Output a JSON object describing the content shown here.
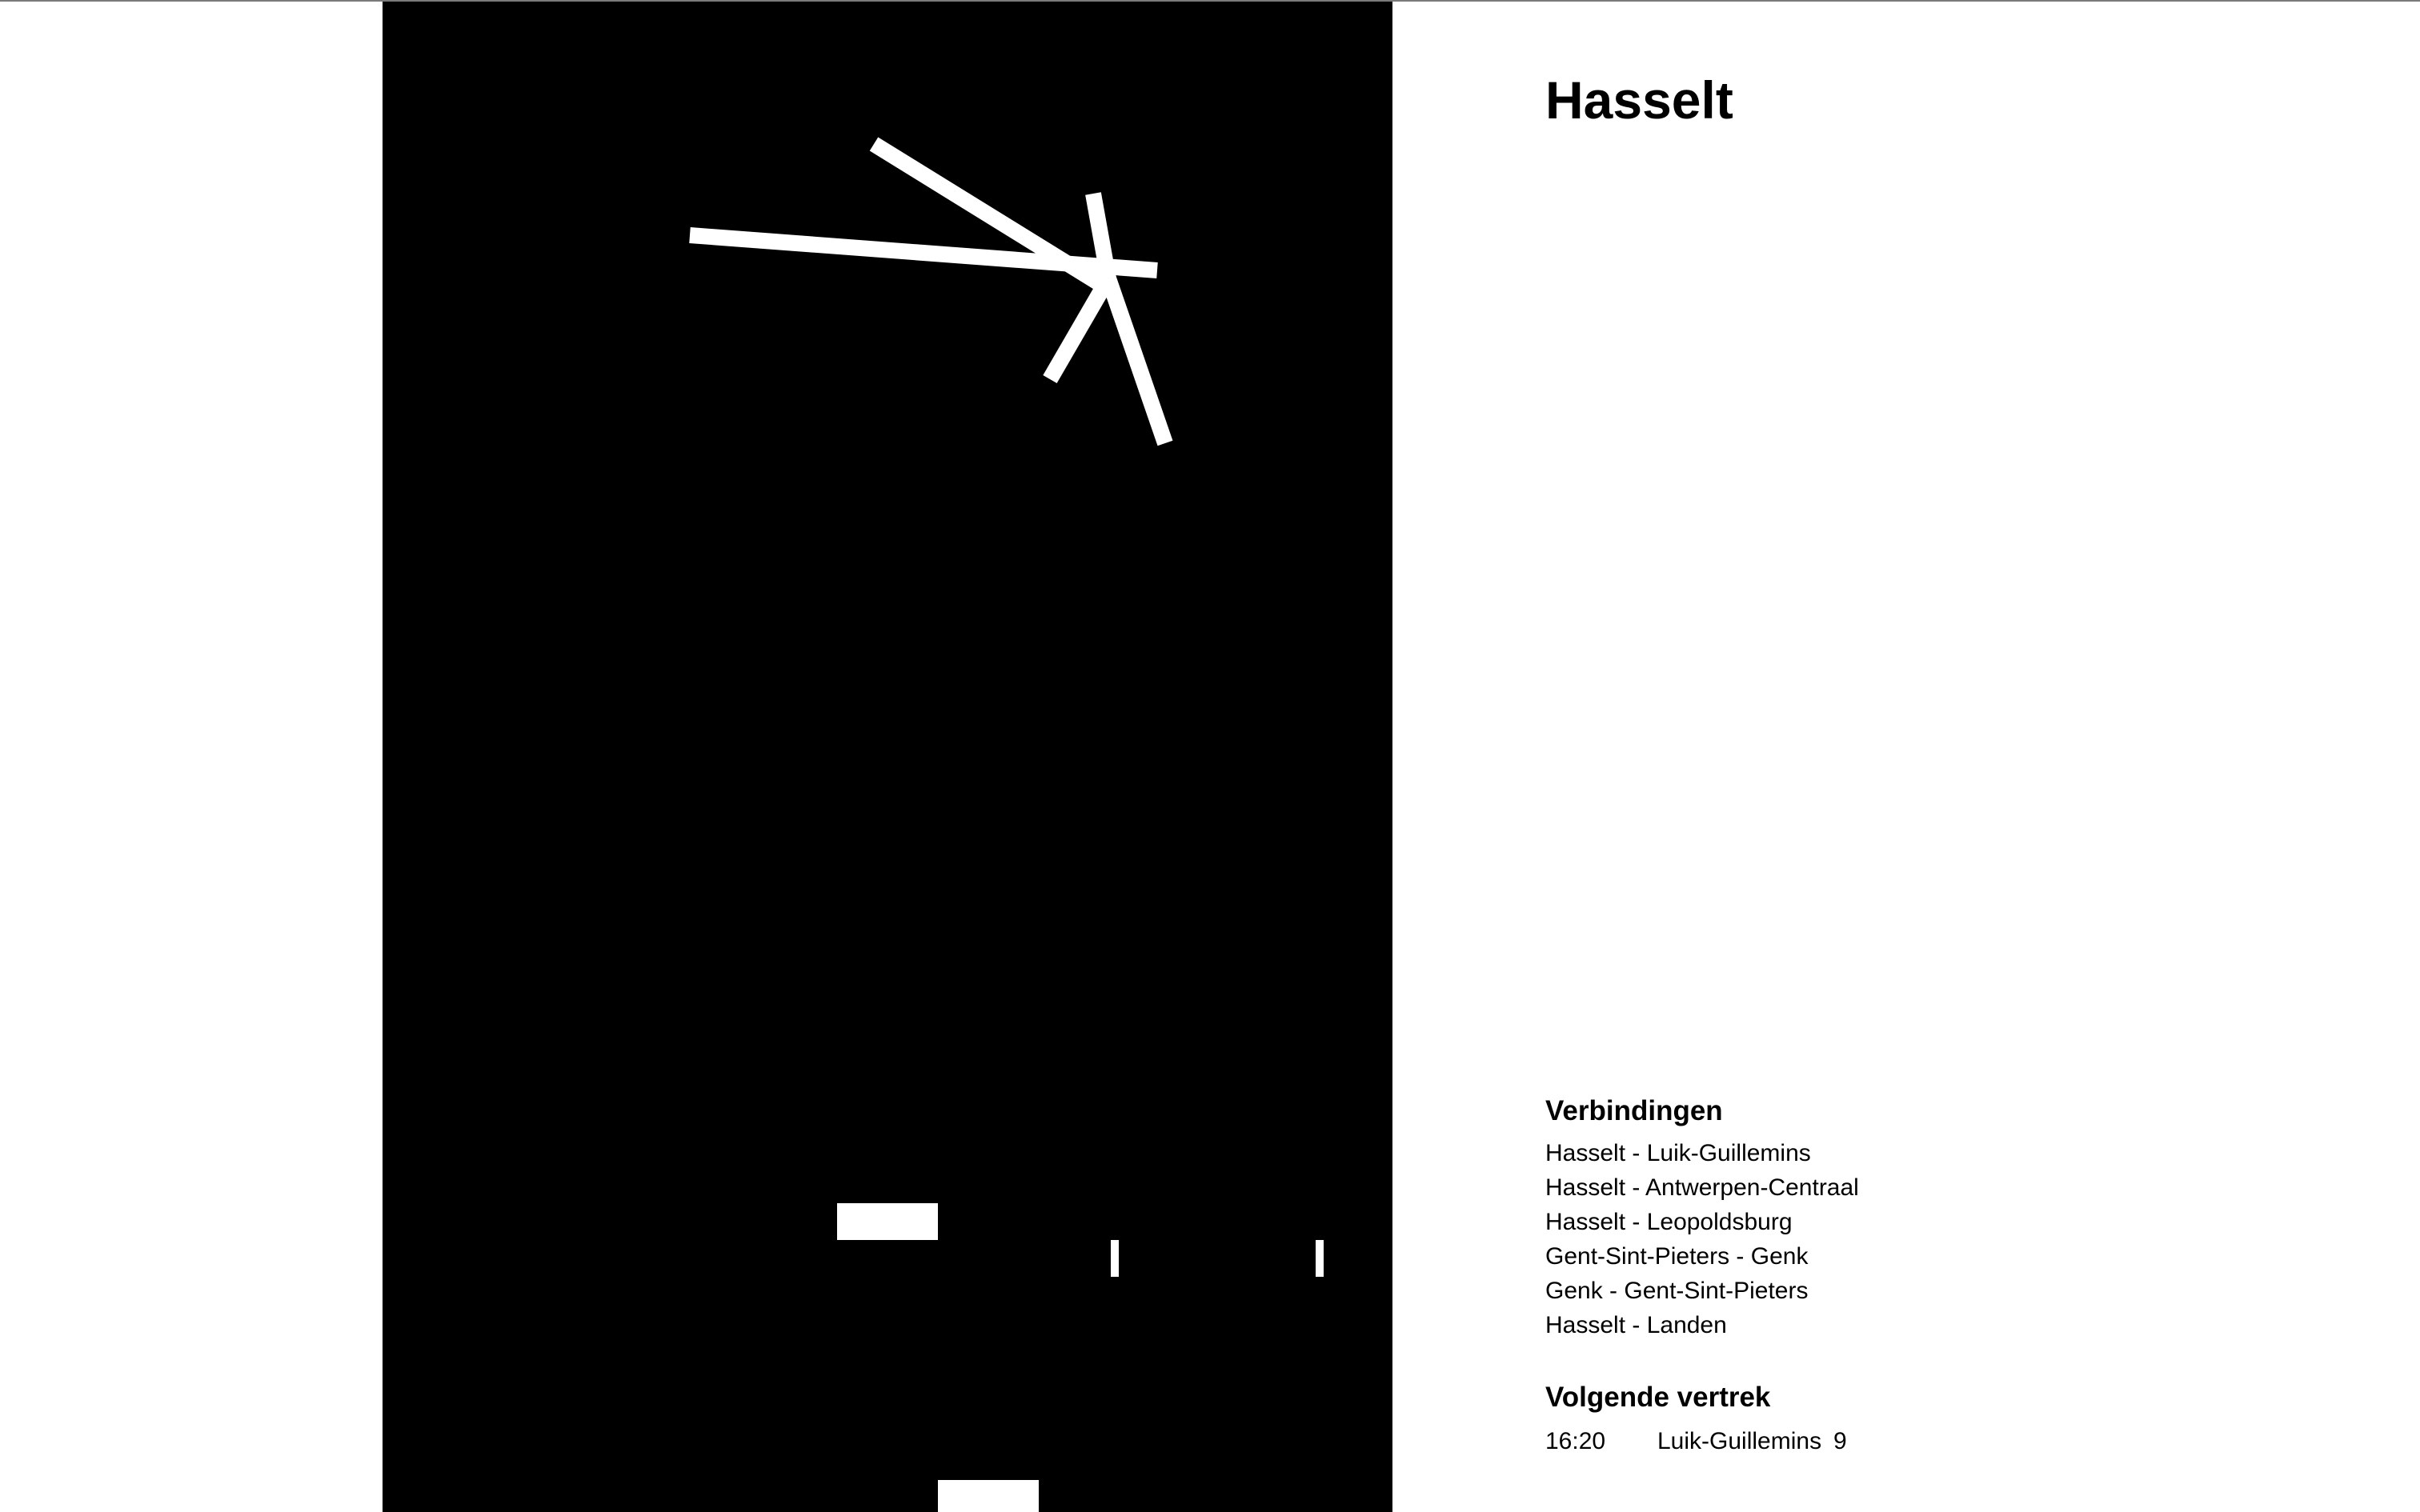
{
  "station": {
    "name": "Hasselt"
  },
  "connections": {
    "heading": "Verbindingen",
    "items": [
      "Hasselt - Luik-Guillemins",
      "Hasselt - Antwerpen-Centraal",
      "Hasselt - Leopoldsburg",
      "Gent-Sint-Pieters - Genk",
      "Genk - Gent-Sint-Pieters",
      "Hasselt - Landen"
    ]
  },
  "next_departure": {
    "heading": "Volgende vertrek",
    "time": "16:20",
    "destination": "Luik-Guillemins",
    "platform": "9"
  },
  "colors": {
    "poster_background": "#000000",
    "poster_marks": "#ffffff",
    "page_background": "#ffffff",
    "text": "#000000"
  }
}
